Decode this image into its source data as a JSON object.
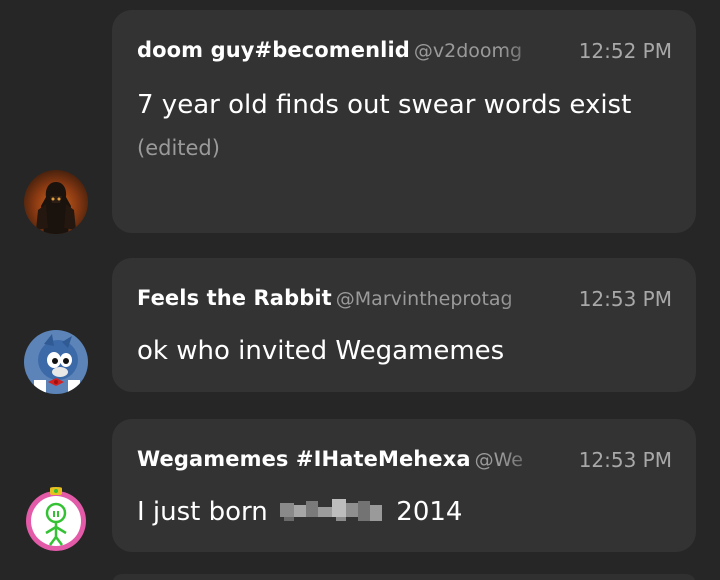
{
  "messages": [
    {
      "name": "doom guy#becomenlid",
      "handle": "@v2doomg",
      "time": "12:52 PM",
      "text": "7 year old finds out swear words exist",
      "edited": "(edited)"
    },
    {
      "name": "Feels the Rabbit",
      "handle": "@Marvintheprotag",
      "time": "12:53 PM",
      "text": "ok who invited Wegamemes"
    },
    {
      "name": "Wegamemes #IHateMehexa",
      "handle": "@We",
      "time": "12:53 PM",
      "text_before": "I just born",
      "text_after": "2014"
    }
  ],
  "colors": {
    "background": "#262626",
    "bubble": "#333333",
    "name": "#ffffff",
    "handle": "#9a9a9a",
    "time": "#a8a8a8"
  },
  "icons": {
    "avatar1": "hooded-warrior-avatar",
    "avatar2": "blue-cartoon-bird-avatar",
    "avatar3": "green-stick-figure-avatar"
  }
}
